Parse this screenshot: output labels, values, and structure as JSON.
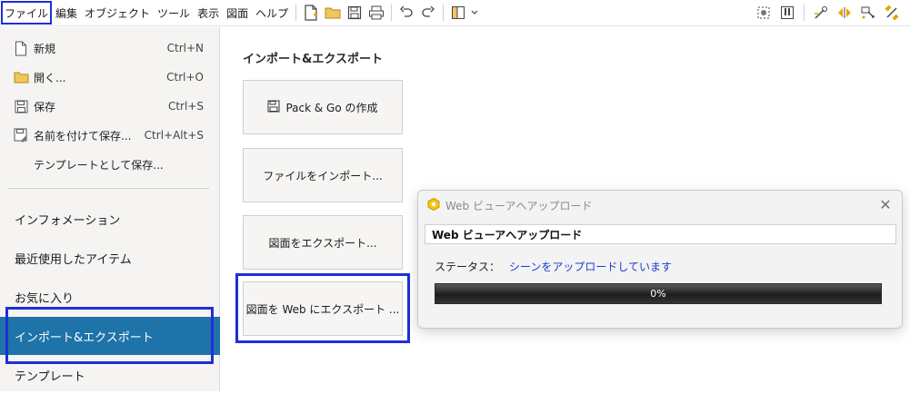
{
  "menubar": {
    "items": [
      "ファイル",
      "編集",
      "オブジェクト",
      "ツール",
      "表示",
      "図面",
      "ヘルプ"
    ]
  },
  "toolbar": {
    "icons": [
      "new-file-icon",
      "open-folder-icon",
      "save-icon",
      "print-icon",
      "undo-icon",
      "redo-icon",
      "layout-icon",
      "chevron-down-icon"
    ],
    "right_icons": [
      "capture-icon",
      "panel-icon",
      "tool-icon",
      "arrows-icon",
      "pointer-icon",
      "satellite-icon"
    ]
  },
  "commands": [
    {
      "label": "新規",
      "shortcut": "Ctrl+N",
      "icon": "new-file-icon"
    },
    {
      "label": "開く...",
      "shortcut": "Ctrl+O",
      "icon": "folder-icon"
    },
    {
      "label": "保存",
      "shortcut": "Ctrl+S",
      "icon": "save-icon"
    },
    {
      "label": "名前を付けて保存...",
      "shortcut": "Ctrl+Alt+S",
      "icon": "save-as-icon"
    },
    {
      "label": "テンプレートとして保存...",
      "shortcut": "",
      "icon": ""
    }
  ],
  "nav": [
    {
      "label": "インフォメーション"
    },
    {
      "label": "最近使用したアイテム"
    },
    {
      "label": "お気に入り"
    },
    {
      "label": "インポート&エクスポート"
    },
    {
      "label": "テンプレート"
    }
  ],
  "main": {
    "title": "インポート&エクスポート",
    "buttons": [
      "Pack & Go の作成",
      "ファイルをインポート...",
      "図面をエクスポート...",
      "図面を Web にエクスポート ..."
    ]
  },
  "dialog": {
    "title": "Web ビューアへアップロード",
    "field_value": "Web ビューアへアップロード",
    "status_label": "ステータス：",
    "status_value": "シーンをアップロードしています",
    "progress_text": "0%",
    "progress_fraction": 0.0
  },
  "colors": {
    "accent": "#1e73a8",
    "highlight": "#1f2fd6",
    "status_text": "#1f3bd0"
  }
}
